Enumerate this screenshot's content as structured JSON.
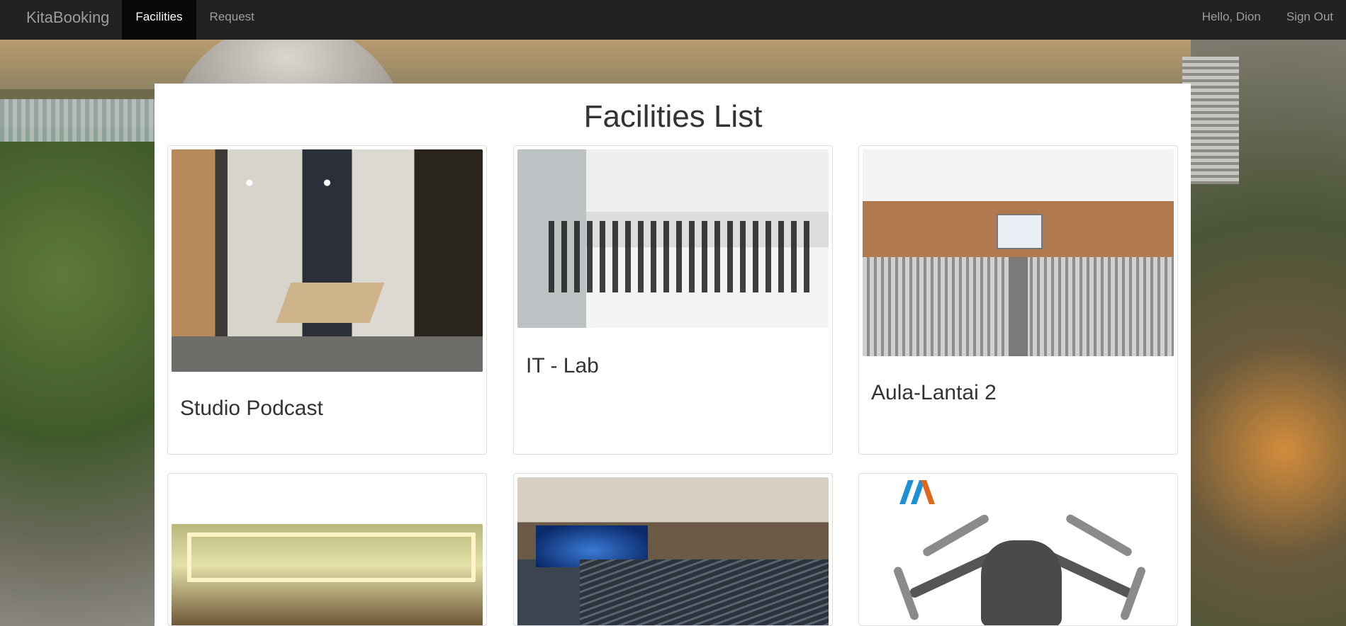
{
  "navbar": {
    "brand": "KitaBooking",
    "items": [
      {
        "label": "Facilities",
        "active": true
      },
      {
        "label": "Request",
        "active": false
      }
    ],
    "greeting": "Hello, Dion",
    "sign_out": "Sign Out",
    "colors": {
      "bar": "#222222",
      "active_bg": "#080808",
      "text": "#9d9d9d",
      "active_text": "#ffffff"
    }
  },
  "main": {
    "title": "Facilities List",
    "facilities": [
      {
        "name": "Studio Podcast",
        "image_icon": "podcast-studio-photo"
      },
      {
        "name": "IT - Lab",
        "image_icon": "computer-lab-photo"
      },
      {
        "name": "Aula-Lantai 2",
        "image_icon": "auditorium-hall-photo"
      },
      {
        "name": "",
        "image_icon": "ballroom-photo"
      },
      {
        "name": "",
        "image_icon": "theater-photo"
      },
      {
        "name": "",
        "image_icon": "drone-photo"
      }
    ]
  }
}
